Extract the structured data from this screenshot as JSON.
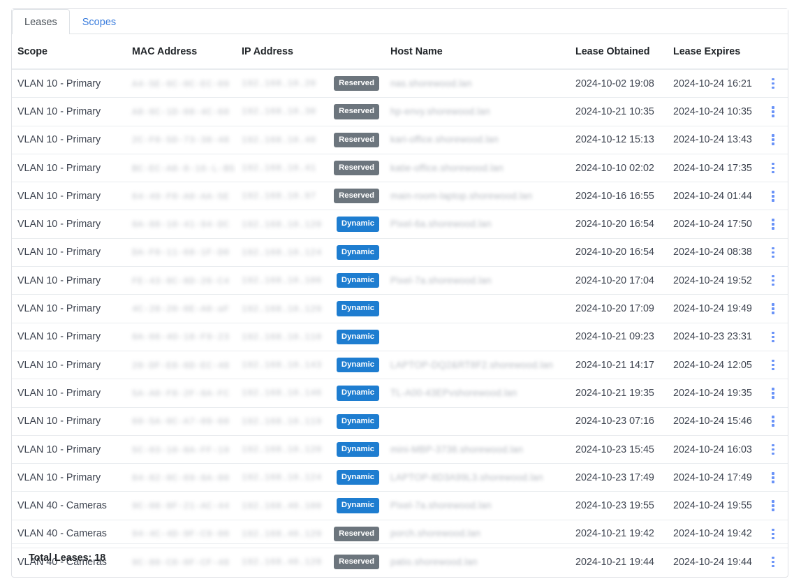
{
  "tabs": [
    {
      "label": "Leases",
      "active": true
    },
    {
      "label": "Scopes",
      "active": false
    }
  ],
  "table": {
    "columns": [
      {
        "key": "scope",
        "label": "Scope"
      },
      {
        "key": "mac",
        "label": "MAC Address"
      },
      {
        "key": "ip",
        "label": "IP Address"
      },
      {
        "key": "host",
        "label": "Host Name"
      },
      {
        "key": "obtained",
        "label": "Lease Obtained"
      },
      {
        "key": "expires",
        "label": "Lease Expires"
      },
      {
        "key": "actions",
        "label": ""
      }
    ],
    "rows": [
      {
        "scope": "VLAN 10 - Primary",
        "mac": "A4-5E-6C-0C-EC-09",
        "ip": "192.168.10.20",
        "badge": "Reserved",
        "badge_type": "reserved",
        "host": "nas.shorewood.lan",
        "obtained": "2024-10-02 19:08",
        "expires": "2024-10-24 16:21",
        "actions": "kebab-menu-icon"
      },
      {
        "scope": "VLAN 10 - Primary",
        "mac": "A8-6C-1D-08-4C-60",
        "ip": "192.168.10.30",
        "badge": "Reserved",
        "badge_type": "reserved",
        "host": "hp-envy.shorewood.lan",
        "obtained": "2024-10-21 10:35",
        "expires": "2024-10-24 10:35",
        "actions": "kebab-menu-icon"
      },
      {
        "scope": "VLAN 10 - Primary",
        "mac": "2C-F0-5D-73-38-48",
        "ip": "192.168.10.40",
        "badge": "Reserved",
        "badge_type": "reserved",
        "host": "kari-office.shorewood.lan",
        "obtained": "2024-10-12 15:13",
        "expires": "2024-10-24 13:43",
        "actions": "kebab-menu-icon"
      },
      {
        "scope": "VLAN 10 - Primary",
        "mac": "BC-EC-A8-8-16-L-B5",
        "ip": "192.168.10.41",
        "badge": "Reserved",
        "badge_type": "reserved",
        "host": "katie-office.shorewood.lan",
        "obtained": "2024-10-10 02:02",
        "expires": "2024-10-24 17:35",
        "actions": "kebab-menu-icon"
      },
      {
        "scope": "VLAN 10 - Primary",
        "mac": "64-49-F0-A0-AA-5E",
        "ip": "192.168.10.97",
        "badge": "Reserved",
        "badge_type": "reserved",
        "host": "main-room-laptop.shorewood.lan",
        "obtained": "2024-10-16 16:55",
        "expires": "2024-10-24 01:44",
        "actions": "kebab-menu-icon"
      },
      {
        "scope": "VLAN 10 - Primary",
        "mac": "0A-88-10-41-94-DC",
        "ip": "192.168.10.120",
        "badge": "Dynamic",
        "badge_type": "dynamic",
        "host": "Pixel-6a.shorewood.lan",
        "obtained": "2024-10-20 16:54",
        "expires": "2024-10-24 17:50",
        "actions": "kebab-menu-icon"
      },
      {
        "scope": "VLAN 10 - Primary",
        "mac": "DA-F0-11-68-1F-D0",
        "ip": "192.168.10.124",
        "badge": "Dynamic",
        "badge_type": "dynamic",
        "host": "",
        "obtained": "2024-10-20 16:54",
        "expires": "2024-10-24 08:38",
        "actions": "kebab-menu-icon"
      },
      {
        "scope": "VLAN 10 - Primary",
        "mac": "FE-43-8C-8D-26-C4",
        "ip": "192.168.10.106",
        "badge": "Dynamic",
        "badge_type": "dynamic",
        "host": "Pixel-7a.shorewood.lan",
        "obtained": "2024-10-20 17:04",
        "expires": "2024-10-24 19:52",
        "actions": "kebab-menu-icon"
      },
      {
        "scope": "VLAN 10 - Primary",
        "mac": "4C-28-20-6E-A0-aF",
        "ip": "192.168.10.129",
        "badge": "Dynamic",
        "badge_type": "dynamic",
        "host": "",
        "obtained": "2024-10-20 17:09",
        "expires": "2024-10-24 19:49",
        "actions": "kebab-menu-icon"
      },
      {
        "scope": "VLAN 10 - Primary",
        "mac": "0A-66-4O-18-F9-23",
        "ip": "192.168.10.110",
        "badge": "Dynamic",
        "badge_type": "dynamic",
        "host": "",
        "obtained": "2024-10-21 09:23",
        "expires": "2024-10-23 23:31",
        "actions": "kebab-menu-icon"
      },
      {
        "scope": "VLAN 10 - Primary",
        "mac": "28-DF-E8-6D-EC-48",
        "ip": "192.168.10.143",
        "badge": "Dynamic",
        "badge_type": "dynamic",
        "host": "LAPTOP-DQ2&RT8F2.shorewood.lan",
        "obtained": "2024-10-21 14:17",
        "expires": "2024-10-24 12:05",
        "actions": "kebab-menu-icon"
      },
      {
        "scope": "VLAN 10 - Primary",
        "mac": "5A-A0-F8-2F-8A-FC",
        "ip": "192.168.10.146",
        "badge": "Dynamic",
        "badge_type": "dynamic",
        "host": "TL-A00-43EPvshorewood.lan",
        "obtained": "2024-10-21 19:35",
        "expires": "2024-10-24 19:35",
        "actions": "kebab-menu-icon"
      },
      {
        "scope": "VLAN 10 - Primary",
        "mac": "60-5A-0C-A7-09-60",
        "ip": "192.168.10.119",
        "badge": "Dynamic",
        "badge_type": "dynamic",
        "host": "",
        "obtained": "2024-10-23 07:16",
        "expires": "2024-10-24 15:46",
        "actions": "kebab-menu-icon"
      },
      {
        "scope": "VLAN 10 - Primary",
        "mac": "5C-03-10-8A-FF-19",
        "ip": "192.168.10.120",
        "badge": "Dynamic",
        "badge_type": "dynamic",
        "host": "mini-MBP-3738.shorewood.lan",
        "obtained": "2024-10-23 15:45",
        "expires": "2024-10-24 16:03",
        "actions": "kebab-menu-icon"
      },
      {
        "scope": "VLAN 10 - Primary",
        "mac": "84-82-0C-69-8A-80",
        "ip": "192.168.10.124",
        "badge": "Dynamic",
        "badge_type": "dynamic",
        "host": "LAPTOP-8D3A99L3.shorewood.lan",
        "obtained": "2024-10-23 17:49",
        "expires": "2024-10-24 17:49",
        "actions": "kebab-menu-icon"
      },
      {
        "scope": "VLAN 40 - Cameras",
        "mac": "9C-08-8F-21-AC-44",
        "ip": "192.168.40.100",
        "badge": "Dynamic",
        "badge_type": "dynamic",
        "host": "Pixel-7a.shorewood.lan",
        "obtained": "2024-10-23 19:55",
        "expires": "2024-10-24 19:55",
        "actions": "kebab-menu-icon"
      },
      {
        "scope": "VLAN 40 - Cameras",
        "mac": "94-4C-4D-9F-C9-00",
        "ip": "192.168.40.129",
        "badge": "Reserved",
        "badge_type": "reserved",
        "host": "porch.shorewood.lan",
        "obtained": "2024-10-21 19:42",
        "expires": "2024-10-24 19:42",
        "actions": "kebab-menu-icon"
      },
      {
        "scope": "VLAN 40 - Cameras",
        "mac": "9C-80-C0-0F-CF-48",
        "ip": "192.168.40.128",
        "badge": "Reserved",
        "badge_type": "reserved",
        "host": "patio.shorewood.lan",
        "obtained": "2024-10-21 19:44",
        "expires": "2024-10-24 19:44",
        "actions": "kebab-menu-icon"
      }
    ]
  },
  "footer": {
    "total_label": "Total Leases: 18"
  },
  "colors": {
    "badge_reserved": "#6c757d",
    "badge_dynamic": "#1e7dd0",
    "link": "#3b7ddd",
    "kebab": "#6a93f8",
    "border": "#e9ecef"
  }
}
